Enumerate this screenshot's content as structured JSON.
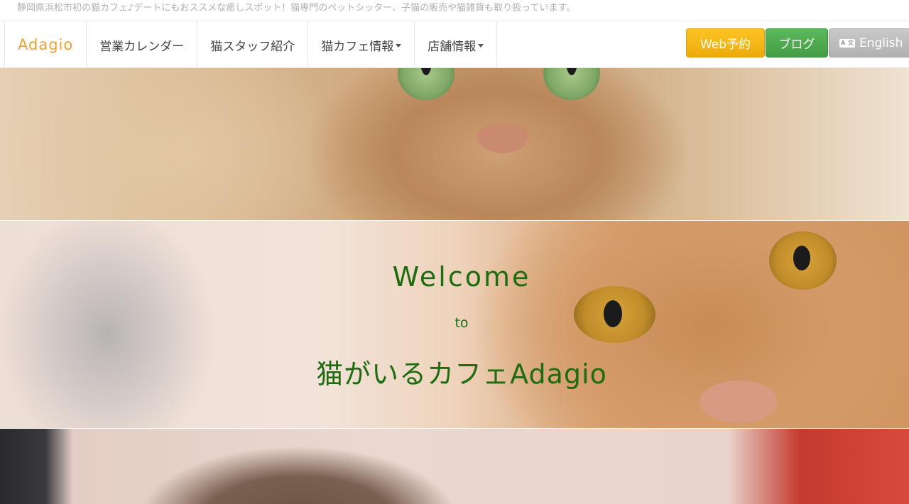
{
  "tagline": "静岡県浜松市初の猫カフェ♪デートにもおススメな癒しスポット！猫専門のペットシッター、子猫の販売や猫雑貨も取り扱っています。",
  "nav": {
    "brand": "Adagio",
    "items": [
      {
        "label": "営業カレンダー",
        "dropdown": false
      },
      {
        "label": "猫スタッフ紹介",
        "dropdown": false
      },
      {
        "label": "猫カフェ情報",
        "dropdown": true
      },
      {
        "label": "店舗情報",
        "dropdown": true
      }
    ],
    "buttons": {
      "web_reserve": "Web予約",
      "blog": "ブログ",
      "english": "English"
    }
  },
  "hero": {
    "line1": "Welcome",
    "line2": "to",
    "line3": "猫がいるカフェAdagio"
  },
  "colors": {
    "brand": "#f0a030",
    "web_button": "#f5b614",
    "blog_button": "#4cae4c",
    "english_button": "#bdbdbd",
    "hero_text": "#1e6b10"
  }
}
